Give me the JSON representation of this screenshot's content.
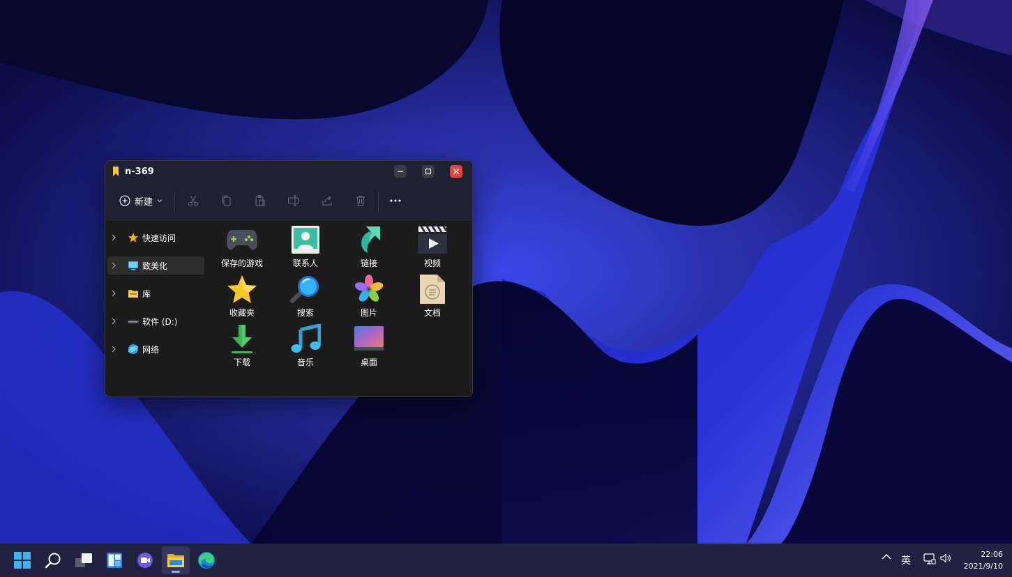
{
  "window": {
    "title": "n-369",
    "controls": {
      "minimize": "minimize",
      "maximize": "maximize",
      "close": "close"
    }
  },
  "toolbar": {
    "new_label": "新建",
    "actions": [
      "cut",
      "copy",
      "paste",
      "rename",
      "share",
      "delete",
      "more"
    ]
  },
  "nav": {
    "items": [
      {
        "label": "快速访问",
        "icon": "star-icon"
      },
      {
        "label": "致美化",
        "icon": "monitor-icon",
        "selected": true
      },
      {
        "label": "库",
        "icon": "folder-icon"
      },
      {
        "label": "软件 (D:)",
        "icon": "drive-icon"
      },
      {
        "label": "网络",
        "icon": "globe-icon"
      }
    ]
  },
  "items": [
    {
      "label": "保存的游戏",
      "icon": "gamepad-icon"
    },
    {
      "label": "联系人",
      "icon": "contacts-icon"
    },
    {
      "label": "链接",
      "icon": "link-arrow-icon"
    },
    {
      "label": "视频",
      "icon": "video-icon"
    },
    {
      "label": "收藏夹",
      "icon": "favorites-star-icon"
    },
    {
      "label": "搜索",
      "icon": "search-icon"
    },
    {
      "label": "图片",
      "icon": "pictures-icon"
    },
    {
      "label": "文档",
      "icon": "document-icon"
    },
    {
      "label": "下载",
      "icon": "download-icon"
    },
    {
      "label": "音乐",
      "icon": "music-icon"
    },
    {
      "label": "桌面",
      "icon": "desktop-icon"
    }
  ],
  "taskbar": {
    "apps": [
      "start",
      "search",
      "task-view",
      "widgets",
      "chat",
      "file-explorer",
      "edge"
    ],
    "active": "file-explorer",
    "tray": {
      "ime": "英",
      "time": "22:06",
      "date": "2021/9/10"
    }
  },
  "colors": {
    "accent_close": "#e2453c",
    "window_bg": "#1c1c1c",
    "taskbar_bg": "#1f2240"
  }
}
